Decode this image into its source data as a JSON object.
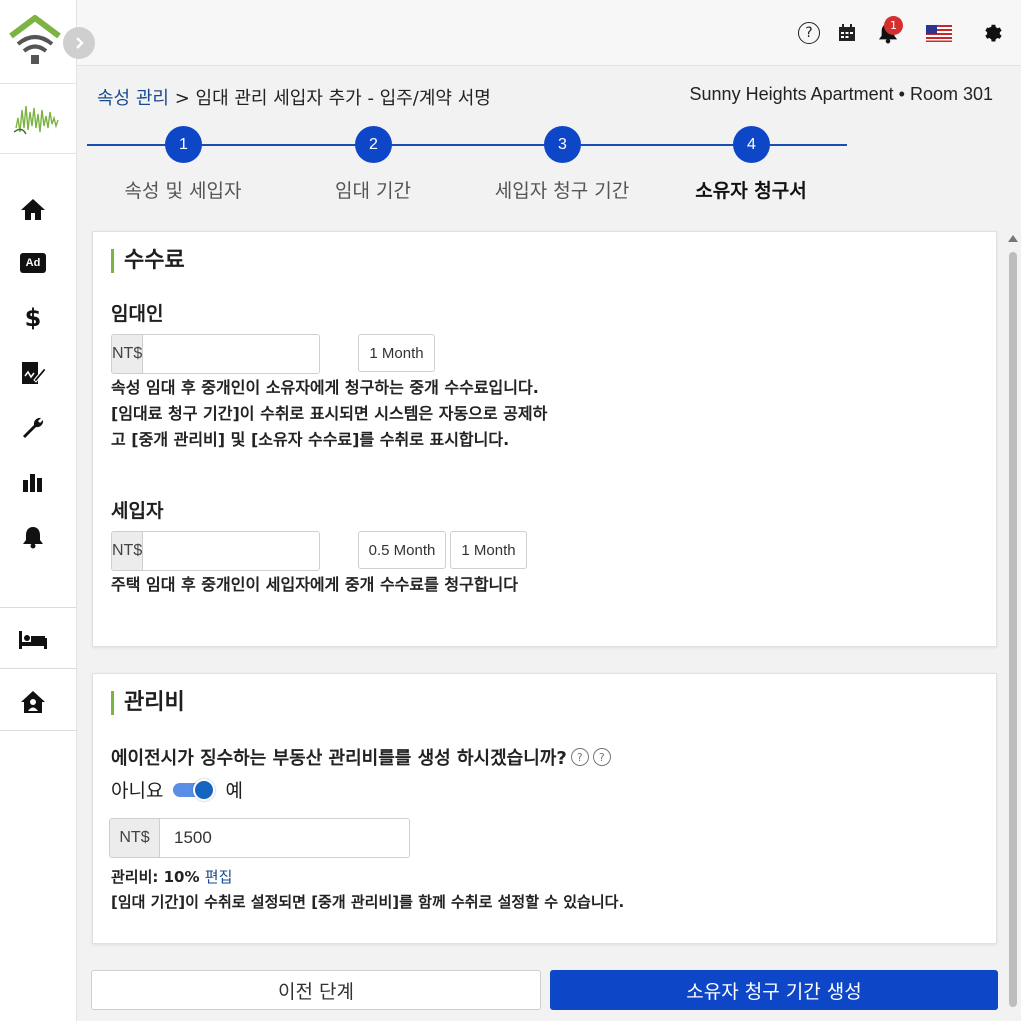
{
  "header": {
    "notification_count": "1",
    "icons": [
      "help-icon",
      "calendar-icon",
      "bell-icon",
      "us-flag-icon",
      "gear-icon"
    ]
  },
  "sidebar": {
    "icons": [
      "home-icon",
      "ad-icon",
      "dollar-icon",
      "contract-icon",
      "wrench-icon",
      "chart-icon",
      "bell-icon",
      "bed-icon",
      "house-user-icon"
    ],
    "ad_label": "Ad"
  },
  "breadcrumb": {
    "root": "속성 관리",
    "separator": ">",
    "rest": "임대 관리 세입자 추가 - 입주/계약 서명"
  },
  "property_info": "Sunny Heights Apartment • Room 301",
  "steps": [
    {
      "number": "1",
      "label": "속성 및 세입자",
      "active": false
    },
    {
      "number": "2",
      "label": "임대 기간",
      "active": false
    },
    {
      "number": "3",
      "label": "세입자 청구 기간",
      "active": false
    },
    {
      "number": "4",
      "label": "소유자 청구서",
      "active": true
    }
  ],
  "commission": {
    "title": "수수료",
    "landlord": {
      "label": "임대인",
      "currency": "NT$",
      "value": "",
      "chips": [
        "1 Month"
      ],
      "description": "속성 임대 후 중개인이 소유자에게 청구하는 중개 수수료입니다. [임대료 청구 기간]이 수취로 표시되면 시스템은 자동으로 공제하고 [중개 관리비] 및 [소유자 수수료]를 수취로 표시합니다."
    },
    "tenant": {
      "label": "세입자",
      "currency": "NT$",
      "value": "",
      "chips": [
        "0.5 Month",
        "1 Month"
      ],
      "description": "주택 임대 후 중개인이 세입자에게 중개 수수료를 청구합니다"
    }
  },
  "management": {
    "title": "관리비",
    "question": "에이전시가 징수하는 부동산 관리비를를 생성 하시겠습니까?",
    "toggle_no": "아니요",
    "toggle_yes": "예",
    "toggle_on": true,
    "currency": "NT$",
    "value": "1500",
    "fee_label": "관리비: 10%",
    "edit_link": "편집",
    "note": "[임대 기간]이 수취로 설정되면 [중개 관리비]를 함께 수취로 설정할 수 있습니다."
  },
  "buttons": {
    "prev": "이전 단계",
    "next": "소유자 청구 기간 생성"
  },
  "colors": {
    "primary": "#0d47c7",
    "accent_green": "#7cb342",
    "badge_red": "#d32f2f"
  }
}
